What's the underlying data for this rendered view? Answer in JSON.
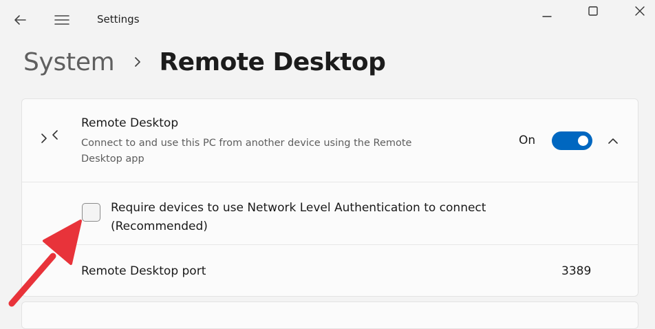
{
  "window": {
    "title": "Settings"
  },
  "breadcrumb": {
    "parent": "System",
    "current": "Remote Desktop"
  },
  "remote_desktop": {
    "title": "Remote Desktop",
    "description": "Connect to and use this PC from another device using the Remote Desktop app",
    "toggle_label": "On",
    "toggle_on": true,
    "accent": "#0067c0"
  },
  "nla": {
    "label": "Require devices to use Network Level Authentication to connect (Recommended)",
    "checked": false
  },
  "port": {
    "label": "Remote Desktop port",
    "value": "3389"
  },
  "icons": {
    "back": "back-arrow-icon",
    "menu": "hamburger-menu-icon",
    "minimize": "minimize-icon",
    "maximize": "maximize-icon",
    "close": "close-icon",
    "remote_desktop": "remote-desktop-icon",
    "collapse": "chevron-up-icon"
  },
  "annotation": {
    "arrow_color": "#e8333a"
  }
}
